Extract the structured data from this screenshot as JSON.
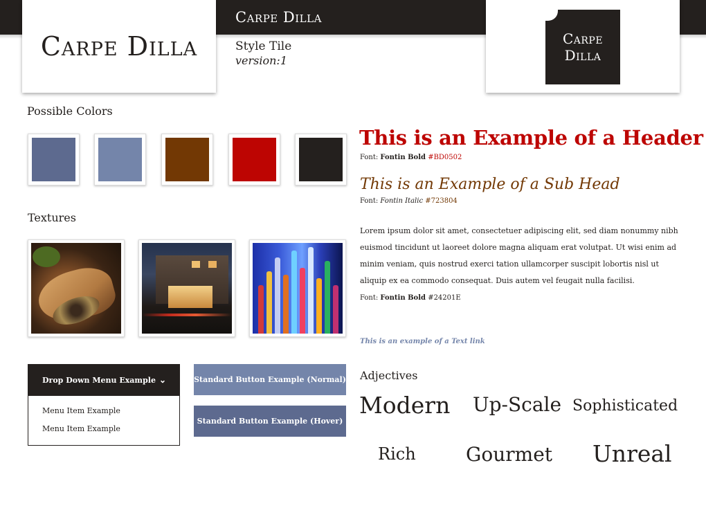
{
  "brand": {
    "logo_text": "Carpe Dilla",
    "title": "Carpe Dilla",
    "logo_box_line1": "Carpe",
    "logo_box_line2": "Dilla",
    "style_tile_label": "Style Tile",
    "version_label": "version:1"
  },
  "colors_section": {
    "label": "Possible Colors",
    "swatches": [
      "#5D6A8F",
      "#7485AA",
      "#723804",
      "#BD0502",
      "#24201E"
    ]
  },
  "textures_section": {
    "label": "Textures"
  },
  "dropdown": {
    "label": "Drop Down Menu Example",
    "items": [
      "Menu Item Example",
      "Menu Item Example"
    ]
  },
  "buttons": {
    "normal_label": "Standard Button Example (Normal)",
    "hover_label": "Standard Button Example (Hover)"
  },
  "typography": {
    "header_text": "This is an Example of a Header",
    "header_font_prefix": "Font: ",
    "header_font_name": "Fontin Bold",
    "header_font_hex": "#BD0502",
    "subhead_text": "This is an Example of a Sub Head",
    "subhead_font_prefix": "Font: ",
    "subhead_font_name": "Fontin Italic",
    "subhead_font_hex": "#723804",
    "body_text": "Lorem ipsum dolor sit amet, consectetuer adipiscing elit, sed diam nonummy nibh euismod tincidunt ut laoreet dolore magna aliquam erat volutpat. Ut wisi enim ad minim veniam, quis nostrud exerci tation ullamcorper suscipit lobortis nisl ut aliquip ex ea commodo consequat. Duis autem vel feugait nulla facilisi.",
    "body_font_prefix": "Font: ",
    "body_font_name": "Fontin Bold",
    "body_font_hex": "#24201E",
    "link_text": "This is an example of a Text link"
  },
  "adjectives": {
    "label": "Adjectives",
    "words": [
      "Modern",
      "Up-Scale",
      "Sophisticated",
      "Rich",
      "Gourmet",
      "Unreal"
    ]
  }
}
